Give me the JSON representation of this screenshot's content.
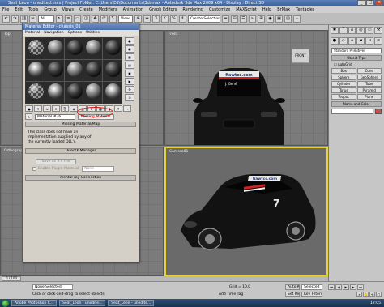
{
  "app": {
    "title": "Seat_Leon - unedited.max  |  Project Folder: C:\\Users\\Ed\\Documents\\3dsmax  -  Autodesk 3ds Max 2009 x64  -  Display : Direct 3D"
  },
  "menubar": [
    "File",
    "Edit",
    "Tools",
    "Group",
    "Views",
    "Create",
    "Modifiers",
    "Animation",
    "Graph Editors",
    "Rendering",
    "Customize",
    "MAXScript",
    "Help",
    "BrMax",
    "Tentacles"
  ],
  "toolbar": {
    "filter": "All",
    "refcoord": "View",
    "selection_set": "Create Selection Set"
  },
  "viewports": {
    "top": "Top",
    "front": "Front",
    "left": "Left",
    "perspective": "Perspective",
    "orthographic": "Orthographic",
    "camera": "Camera01",
    "viewcube_label": "FRONT"
  },
  "car": {
    "banner_text": "fiawtcc.com",
    "sponsor_text": "J. Gené",
    "number": "7"
  },
  "command_panel": {
    "object_type_select": "Standard Primitives",
    "rollout_object_type": "Object Type",
    "autogrid": "AutoGrid",
    "objects": [
      "Box",
      "Cone",
      "Sphere",
      "GeoSphere",
      "Cylinder",
      "Tube",
      "Torus",
      "Pyramid",
      "Teapot",
      "Plane"
    ],
    "rollout_name_color": "Name and Color"
  },
  "material_editor": {
    "title": "Material Editor - chassis_01",
    "menu": [
      "Material",
      "Navigation",
      "Options",
      "Utilities"
    ],
    "material_name": "Material #26",
    "type_button": "Missing Material",
    "rollout_missing_map": "Missing Material/Map",
    "missing_text": "This class does not have an implementation supplied by any of the currently loaded DLL's.",
    "rollout_directx": "DirectX Manager",
    "save_fx_button": "Save as .FX File",
    "enable_plugin_label": "Enable Plugin Material",
    "enable_plugin_value": "None",
    "rollout_mental_ray": "mental ray Connection"
  },
  "status": {
    "selection": "None Selected",
    "prompt": "Click or click-and-drag to select objects",
    "grid": "Grid = 10,0",
    "auto_key": "Auto Key",
    "selected": "Selected",
    "set_key": "Set Key",
    "key_filters": "Key Filters...",
    "frame": "0 / 100",
    "add_time_tag": "Add Time Tag"
  },
  "taskbar": {
    "items": [
      "Adobe Photoshop C...",
      "Seat_Leon - unedite...",
      "Seat_Leon - unedite..."
    ],
    "clock": "12:05"
  },
  "colors": {
    "active_viewport_border": "#e8d23a",
    "missing_highlight": "#e01010"
  }
}
